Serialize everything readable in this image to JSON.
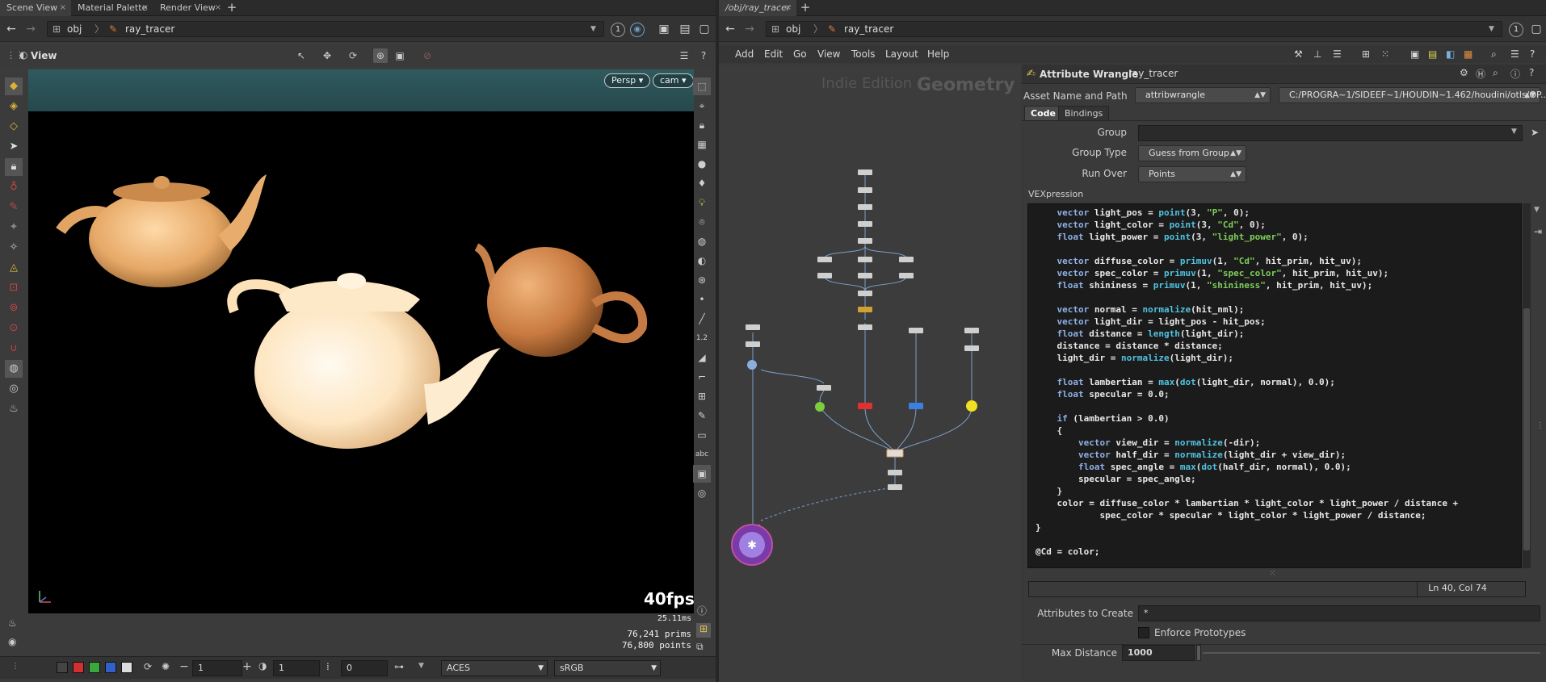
{
  "left": {
    "tabs": [
      "Scene View",
      "Material Palette",
      "Render View"
    ],
    "path": {
      "root": "obj",
      "node": "ray_tracer",
      "pin": "1"
    },
    "view_title": "View",
    "viewport": {
      "camera_pills": [
        "Persp ▾",
        "cam ▾"
      ],
      "fps": "40fps",
      "ms": "25.11ms",
      "prims_label": "76,241  prims",
      "points_label": "76,800 points"
    },
    "status": {
      "frame_a": "1",
      "frame_b": "1",
      "offset": "0",
      "colorspace": "ACES",
      "display": "sRGB"
    }
  },
  "right": {
    "tab": "/obj/ray_tracer",
    "path": {
      "root": "obj",
      "node": "ray_tracer",
      "pin": "1"
    },
    "menu": [
      "Add",
      "Edit",
      "Go",
      "View",
      "Tools",
      "Layout",
      "Help"
    ],
    "network_watermark": {
      "edition": "Indie Edition",
      "context": "Geometry"
    },
    "params": {
      "node_type": "Attribute Wrangle",
      "node_name": "ray_tracer",
      "asset_label": "Asset Name and Path",
      "asset_name": "attribwrangle",
      "asset_path": "C:/PROGRA~1/SIDEEF~1/HOUDIN~1.462/houdini/otls/OP...",
      "tabs": [
        "Code",
        "Bindings"
      ],
      "group_label": "Group",
      "group_value": "",
      "group_type_label": "Group Type",
      "group_type_value": "Guess from Group",
      "run_over_label": "Run Over",
      "run_over_value": "Points",
      "vex_label": "VEXpression",
      "cursor_pos": "Ln 40, Col 74",
      "attrs_label": "Attributes to Create",
      "attrs_value": "*",
      "enforce_label": "Enforce Prototypes",
      "max_dist_label": "Max Distance",
      "max_dist_value": "1000"
    }
  }
}
